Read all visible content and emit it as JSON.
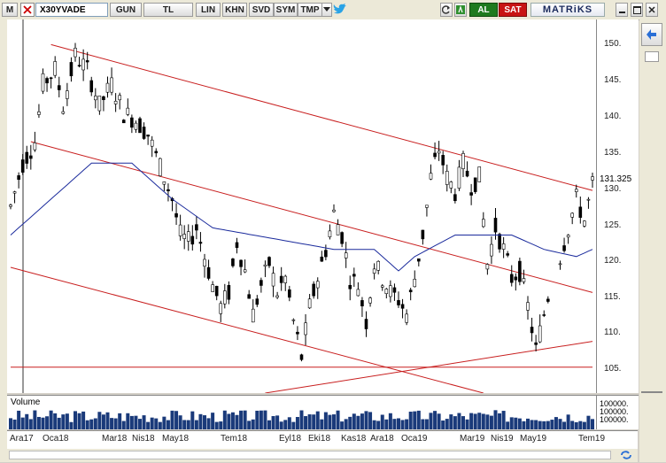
{
  "toolbar": {
    "menu": "M",
    "symbol": "X30YVADE",
    "period": "GUN",
    "currency": "TL",
    "buttons": [
      "LIN",
      "KHN",
      "SVD",
      "SYM",
      "TMP"
    ],
    "buy": "AL",
    "sell": "SAT",
    "brand": "MATRiKS"
  },
  "colors": {
    "bg": "#ffffff",
    "price": "#000000",
    "ma": "#1a2a9c",
    "channel": "#c81e1e",
    "volume": "#1a3a7a",
    "buy": "#1e7a1e",
    "sell": "#c81414"
  },
  "icons": [
    "twitter-icon",
    "refresh-icon",
    "formula-icon",
    "arrow-left-icon",
    "grid-icon"
  ],
  "price_ticks": [
    "150.",
    "145.",
    "140.",
    "135.",
    "130.",
    "125.",
    "120.",
    "115.",
    "110.",
    "105."
  ],
  "last_price": "131.325",
  "volume": {
    "title": "Volume",
    "tick": "100000."
  },
  "dates": [
    "Ara17",
    "Oca18",
    "Mar18",
    "Nis18",
    "May18",
    "Tem18",
    "Eyl18",
    "Eki18",
    "Kas18",
    "Ara18",
    "Oca19",
    "Mar19",
    "Nis19",
    "May19",
    "Tem19"
  ],
  "chart_data": {
    "type": "candlestick",
    "symbol": "X30YVADE",
    "ylim": [
      102,
      154
    ],
    "ticks": [
      150,
      145,
      140,
      135,
      130,
      125,
      120,
      115,
      110,
      105
    ],
    "last": 131.325,
    "price_path": [
      [
        0,
        128
      ],
      [
        3,
        134
      ],
      [
        6,
        137
      ],
      [
        8,
        145
      ],
      [
        11,
        147
      ],
      [
        13,
        142
      ],
      [
        16,
        149
      ],
      [
        19,
        147
      ],
      [
        22,
        142
      ],
      [
        25,
        145
      ],
      [
        28,
        141
      ],
      [
        31,
        140
      ],
      [
        34,
        138
      ],
      [
        36,
        135
      ],
      [
        38,
        132
      ],
      [
        40,
        129
      ],
      [
        42,
        124
      ],
      [
        44,
        123
      ],
      [
        46,
        125
      ],
      [
        48,
        121
      ],
      [
        50,
        117
      ],
      [
        52,
        114
      ],
      [
        54,
        116
      ],
      [
        56,
        123
      ],
      [
        58,
        119
      ],
      [
        60,
        113
      ],
      [
        62,
        117
      ],
      [
        64,
        120
      ],
      [
        66,
        116
      ],
      [
        68,
        118
      ],
      [
        70,
        112
      ],
      [
        72,
        107
      ],
      [
        74,
        114
      ],
      [
        76,
        118
      ],
      [
        78,
        122
      ],
      [
        80,
        127
      ],
      [
        82,
        124
      ],
      [
        84,
        118
      ],
      [
        86,
        117
      ],
      [
        88,
        112
      ],
      [
        90,
        120
      ],
      [
        92,
        118
      ],
      [
        94,
        116
      ],
      [
        96,
        115
      ],
      [
        98,
        113
      ],
      [
        100,
        118
      ],
      [
        102,
        124
      ],
      [
        104,
        132
      ],
      [
        106,
        136
      ],
      [
        108,
        132
      ],
      [
        110,
        130
      ],
      [
        112,
        134
      ],
      [
        114,
        131
      ],
      [
        116,
        132
      ],
      [
        118,
        120
      ],
      [
        120,
        125
      ],
      [
        122,
        122
      ],
      [
        124,
        118
      ],
      [
        126,
        119
      ],
      [
        128,
        114
      ],
      [
        130,
        108
      ],
      [
        132,
        113
      ],
      [
        134,
        118
      ],
      [
        136,
        121
      ],
      [
        140,
        129
      ],
      [
        142,
        126
      ],
      [
        144,
        131
      ]
    ],
    "ma_path": [
      [
        0,
        124
      ],
      [
        10,
        129
      ],
      [
        20,
        134
      ],
      [
        30,
        134
      ],
      [
        40,
        129
      ],
      [
        50,
        125
      ],
      [
        60,
        124
      ],
      [
        70,
        123
      ],
      [
        80,
        122
      ],
      [
        90,
        122
      ],
      [
        96,
        119
      ],
      [
        100,
        121
      ],
      [
        110,
        124
      ],
      [
        116,
        124
      ],
      [
        124,
        124
      ],
      [
        132,
        122
      ],
      [
        140,
        121
      ],
      [
        144,
        122
      ]
    ],
    "channel_lines": [
      {
        "from": [
          10,
          150.5
        ],
        "to": [
          144,
          130.2
        ]
      },
      {
        "from": [
          5,
          137
        ],
        "to": [
          144,
          116
        ]
      },
      {
        "from": [
          0,
          119.5
        ],
        "to": [
          117,
          102
        ]
      },
      {
        "from": [
          63,
          102
        ],
        "to": [
          144,
          109.2
        ]
      },
      {
        "from": [
          0,
          105.6
        ],
        "to": [
          144,
          105.6
        ]
      }
    ]
  }
}
